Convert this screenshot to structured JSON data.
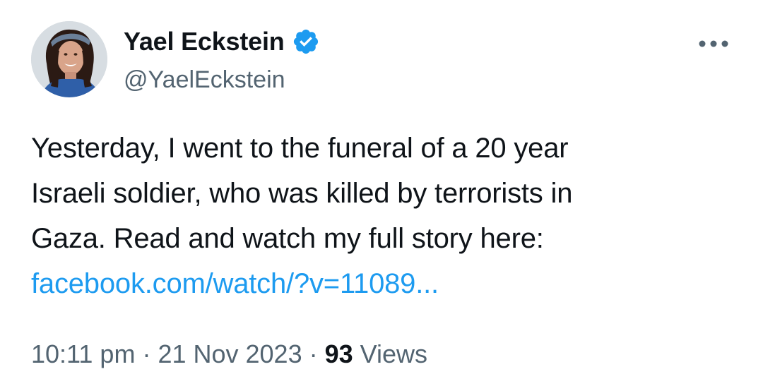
{
  "author": {
    "display_name": "Yael Eckstein",
    "handle": "@YaelEckstein",
    "verified": true,
    "verified_color": "#1d9bf0",
    "avatar": "profile-photo"
  },
  "tweet": {
    "text_lines": [
      "Yesterday, I went to the funeral of a 20 year",
      "Israeli soldier, who was killed by terrorists in",
      "Gaza. Read and watch my full story here:"
    ],
    "link_text": "facebook.com/watch/?v=11089...",
    "link_color": "#1d9bf0"
  },
  "meta": {
    "time": "10:11 pm",
    "separator": "·",
    "date": "21 Nov 2023",
    "views_count": "93",
    "views_label": "Views"
  },
  "icons": {
    "more": "more-horizontal-icon",
    "verified": "verified-badge-icon"
  }
}
